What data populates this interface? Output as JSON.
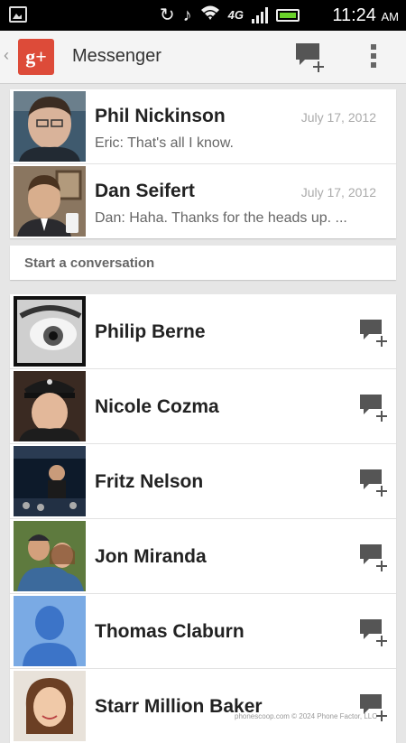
{
  "status_bar": {
    "time": "11:24",
    "ampm": "AM",
    "network": "4G",
    "icons": [
      "image-icon",
      "sync-icon",
      "mute-icon",
      "wifi-icon",
      "signal-icon",
      "battery-icon"
    ]
  },
  "action_bar": {
    "app_icon": "google-plus-icon",
    "app_icon_text": "g+",
    "title": "Messenger",
    "actions": [
      "new-conversation-icon",
      "overflow-menu-icon"
    ]
  },
  "conversations": [
    {
      "name": "Phil Nickinson",
      "date": "July 17, 2012",
      "preview": "Eric: That's all I know."
    },
    {
      "name": "Dan Seifert",
      "date": "July 17, 2012",
      "preview": "Dan: Haha. Thanks for the heads up. ..."
    }
  ],
  "section": {
    "label": "Start a conversation"
  },
  "contacts": [
    {
      "name": "Philip Berne"
    },
    {
      "name": "Nicole Cozma"
    },
    {
      "name": "Fritz Nelson"
    },
    {
      "name": "Jon Miranda"
    },
    {
      "name": "Thomas Claburn"
    },
    {
      "name": "Starr Million Baker"
    }
  ],
  "watermark": "Phone scoop",
  "footer": "phonescoop.com  © 2024 Phone Factor, LLC",
  "colors": {
    "accent": "#dd4b39",
    "status_bar": "#000000",
    "battery": "#6ad12a"
  }
}
